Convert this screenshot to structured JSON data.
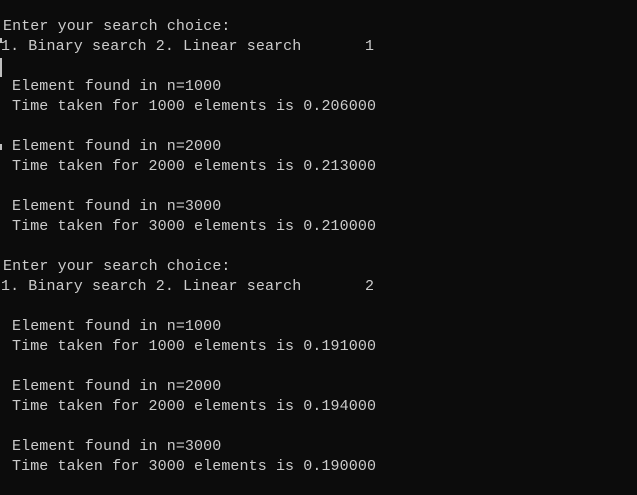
{
  "console": {
    "lines": [
      "Enter your search choice:",
      "1. Binary search 2. Linear search       1",
      "",
      "Element found in n=1000",
      "Time taken for 1000 elements is 0.206000",
      "",
      "Element found in n=2000",
      "Time taken for 2000 elements is 0.213000",
      "",
      "Element found in n=3000",
      "Time taken for 3000 elements is 0.210000",
      "",
      "Enter your search choice:",
      "1. Binary search 2. Linear search       2",
      "",
      "Element found in n=1000",
      "Time taken for 1000 elements is 0.191000",
      "",
      "Element found in n=2000",
      "Time taken for 2000 elements is 0.194000",
      "",
      "Element found in n=3000",
      "Time taken for 3000 elements is 0.190000"
    ]
  }
}
